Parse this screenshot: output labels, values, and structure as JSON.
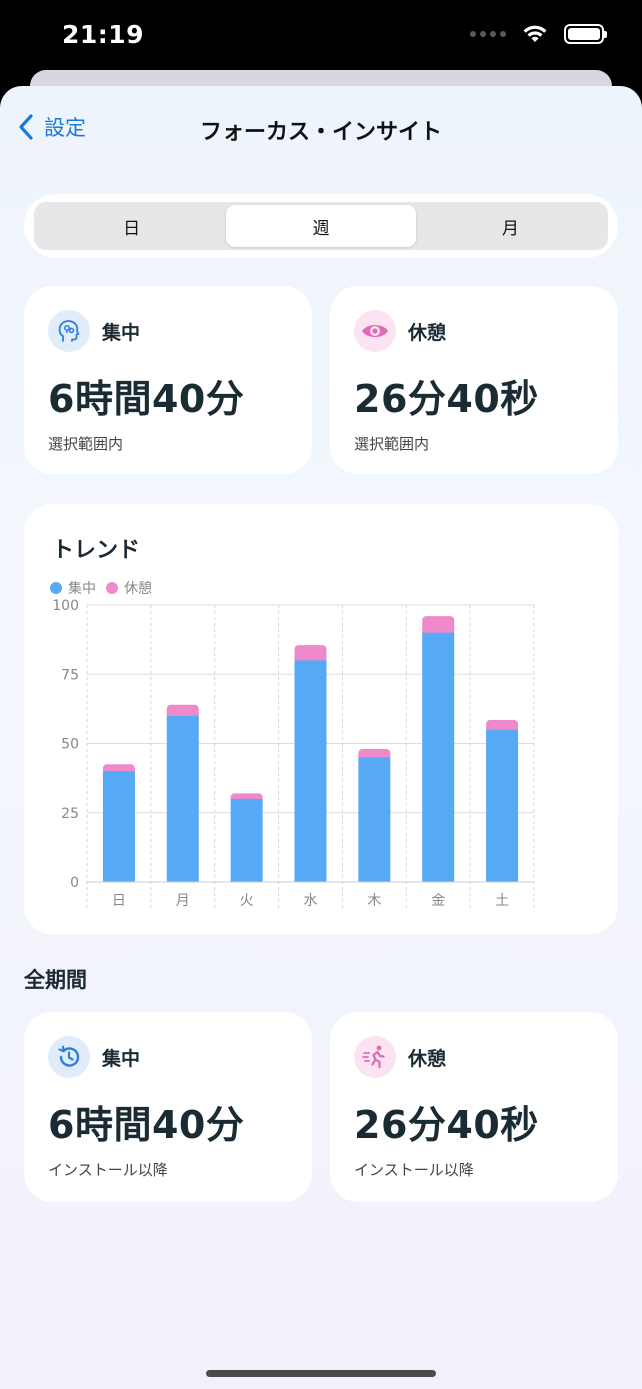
{
  "status": {
    "time": "21:19"
  },
  "nav": {
    "back_label": "設定",
    "title": "フォーカス・インサイト"
  },
  "segments": [
    {
      "label": "日",
      "active": false
    },
    {
      "label": "週",
      "active": true
    },
    {
      "label": "月",
      "active": false
    }
  ],
  "range_stats": {
    "focus": {
      "label": "集中",
      "value": "6時間40分",
      "sub": "選択範囲内"
    },
    "rest": {
      "label": "休憩",
      "value": "26分40秒",
      "sub": "選択範囲内"
    }
  },
  "trend": {
    "title": "トレンド",
    "legend": [
      {
        "name": "集中",
        "color": "#55a9f5"
      },
      {
        "name": "休憩",
        "color": "#ee8acb"
      }
    ]
  },
  "chart_data": {
    "type": "bar",
    "stacked": true,
    "categories": [
      "日",
      "月",
      "火",
      "水",
      "木",
      "金",
      "土"
    ],
    "series": [
      {
        "name": "集中",
        "color": "#55a9f5",
        "values": [
          40,
          60,
          30,
          80,
          45,
          90,
          55
        ]
      },
      {
        "name": "休憩",
        "color": "#ee8acb",
        "values": [
          2.5,
          4,
          2,
          5.5,
          3,
          6,
          3.5
        ]
      }
    ],
    "yticks": [
      "0",
      "25",
      "50",
      "75",
      "100"
    ],
    "ylim": [
      0,
      100
    ],
    "grid": true,
    "legend_position": "top-left"
  },
  "all_time": {
    "section_title": "全期間",
    "focus": {
      "label": "集中",
      "value": "6時間40分",
      "sub": "インストール以降"
    },
    "rest": {
      "label": "休憩",
      "value": "26分40秒",
      "sub": "インストール以降"
    }
  },
  "colors": {
    "accent": "#1a7ad9",
    "focus": "#55a9f5",
    "rest": "#ee8acb"
  },
  "icons": {
    "focus_range": "brain-head-icon",
    "rest_range": "eye-icon",
    "focus_all": "clock-history-icon",
    "rest_all": "running-person-icon"
  }
}
